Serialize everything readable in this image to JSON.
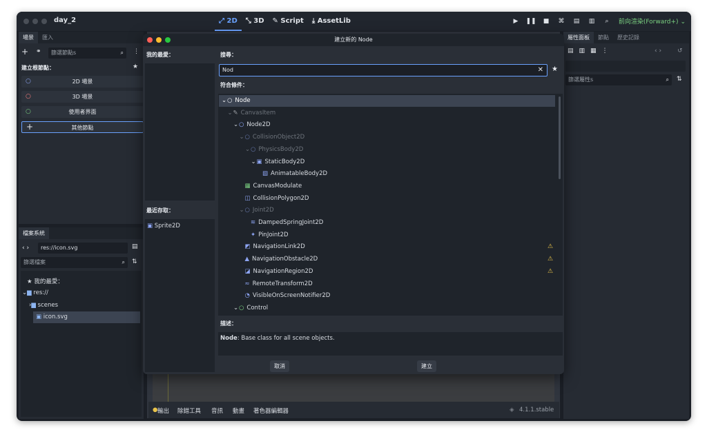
{
  "window": {
    "title": "day_2"
  },
  "topbar": {
    "modes": [
      "2D",
      "3D",
      "Script",
      "AssetLib"
    ],
    "mode_icons": [
      "2d-icon",
      "3d-icon",
      "script-icon",
      "assetlib-icon"
    ],
    "renderer": "前向渲染(Forward+)"
  },
  "scene_panel": {
    "tabs": [
      "場景",
      "匯入"
    ],
    "filter_placeholder": "篩選節點s",
    "create_root_label": "建立根節點：",
    "buttons": [
      "2D 場景",
      "3D 場景",
      "使用者界面",
      "其他節點"
    ]
  },
  "filesystem": {
    "tab": "檔案系統",
    "path": "res://icon.svg",
    "filter_placeholder": "篩選檔案",
    "items": [
      "我的最愛：",
      "res://",
      "scenes",
      "icon.svg"
    ]
  },
  "inspector": {
    "tabs": [
      "屬性面板",
      "節點",
      "歷史記錄"
    ],
    "filter_placeholder": "篩選屬性s"
  },
  "dialog": {
    "title": "建立新的 Node",
    "favorites_label": "我的最愛：",
    "recent_label": "最近存取：",
    "recent_items": [
      "Sprite2D"
    ],
    "search_label": "搜尋：",
    "search_value": "Nod",
    "matches_label": "符合條件：",
    "tree": [
      {
        "name": "Node",
        "icon": "○",
        "color": "#e6e9ee",
        "depth": 0,
        "dim": false,
        "sel": true,
        "warn": false
      },
      {
        "name": "CanvasItem",
        "icon": "✎",
        "color": "#e6e9ee",
        "depth": 1,
        "dim": true,
        "sel": false,
        "warn": false
      },
      {
        "name": "Node2D",
        "icon": "○",
        "color": "#8da5f3",
        "depth": 2,
        "dim": false,
        "sel": false,
        "warn": false
      },
      {
        "name": "CollisionObject2D",
        "icon": "○",
        "color": "#8da5f3",
        "depth": 3,
        "dim": true,
        "sel": false,
        "warn": false
      },
      {
        "name": "PhysicsBody2D",
        "icon": "○",
        "color": "#8da5f3",
        "depth": 4,
        "dim": true,
        "sel": false,
        "warn": false
      },
      {
        "name": "StaticBody2D",
        "icon": "▣",
        "color": "#8da5f3",
        "depth": 5,
        "dim": false,
        "sel": false,
        "warn": false
      },
      {
        "name": "AnimatableBody2D",
        "icon": "▧",
        "color": "#8da5f3",
        "depth": 6,
        "dim": false,
        "sel": false,
        "warn": false
      },
      {
        "name": "CanvasModulate",
        "icon": "▦",
        "color": "#7ad080",
        "depth": 3,
        "dim": false,
        "sel": false,
        "warn": false
      },
      {
        "name": "CollisionPolygon2D",
        "icon": "◫",
        "color": "#8da5f3",
        "depth": 3,
        "dim": false,
        "sel": false,
        "warn": false
      },
      {
        "name": "Joint2D",
        "icon": "○",
        "color": "#8da5f3",
        "depth": 3,
        "dim": true,
        "sel": false,
        "warn": false
      },
      {
        "name": "DampedSpringJoint2D",
        "icon": "≋",
        "color": "#8da5f3",
        "depth": 4,
        "dim": false,
        "sel": false,
        "warn": false
      },
      {
        "name": "PinJoint2D",
        "icon": "✦",
        "color": "#8da5f3",
        "depth": 4,
        "dim": false,
        "sel": false,
        "warn": false
      },
      {
        "name": "NavigationLink2D",
        "icon": "◩",
        "color": "#8da5f3",
        "depth": 3,
        "dim": false,
        "sel": false,
        "warn": true
      },
      {
        "name": "NavigationObstacle2D",
        "icon": "▲",
        "color": "#8da5f3",
        "depth": 3,
        "dim": false,
        "sel": false,
        "warn": true
      },
      {
        "name": "NavigationRegion2D",
        "icon": "◪",
        "color": "#8da5f3",
        "depth": 3,
        "dim": false,
        "sel": false,
        "warn": true
      },
      {
        "name": "RemoteTransform2D",
        "icon": "≈",
        "color": "#8da5f3",
        "depth": 3,
        "dim": false,
        "sel": false,
        "warn": false
      },
      {
        "name": "VisibleOnScreenNotifier2D",
        "icon": "◔",
        "color": "#8da5f3",
        "depth": 3,
        "dim": false,
        "sel": false,
        "warn": false
      },
      {
        "name": "Control",
        "icon": "○",
        "color": "#7ad080",
        "depth": 2,
        "dim": false,
        "sel": false,
        "warn": false
      }
    ],
    "description_label": "描述：",
    "description_node": "Node",
    "description_text": ": Base class for all scene objects.",
    "cancel": "取消",
    "create": "建立"
  },
  "bottom_bar": {
    "tabs": [
      "輸出",
      "除錯工具",
      "音訊",
      "動畫",
      "著色器編輯器"
    ],
    "version": "4.1.1.stable"
  }
}
